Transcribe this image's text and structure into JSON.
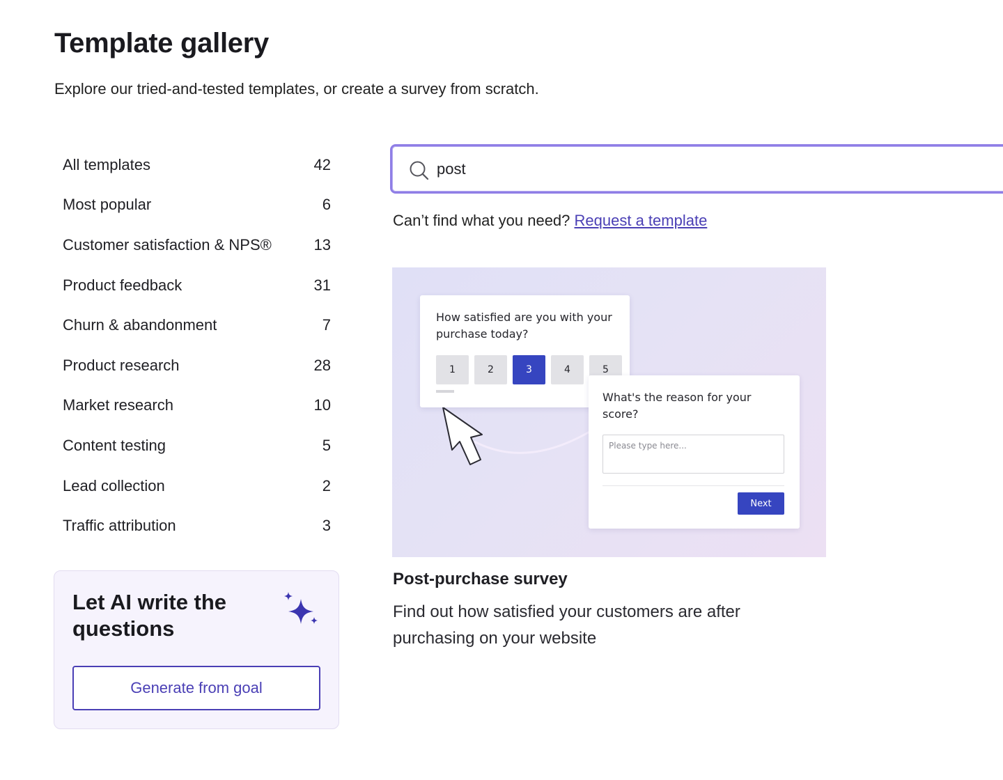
{
  "header": {
    "title": "Template gallery",
    "subtitle": "Explore our tried-and-tested templates, or create a survey from scratch."
  },
  "sidebar": {
    "categories": [
      {
        "label": "All templates",
        "count": "42"
      },
      {
        "label": "Most popular",
        "count": "6"
      },
      {
        "label": "Customer satisfaction & NPS®",
        "count": "13"
      },
      {
        "label": "Product feedback",
        "count": "31"
      },
      {
        "label": "Churn & abandonment",
        "count": "7"
      },
      {
        "label": "Product research",
        "count": "28"
      },
      {
        "label": "Market research",
        "count": "10"
      },
      {
        "label": "Content testing",
        "count": "5"
      },
      {
        "label": "Lead collection",
        "count": "2"
      },
      {
        "label": "Traffic attribution",
        "count": "3"
      }
    ],
    "ai_card": {
      "title": "Let AI write the questions",
      "button_label": "Generate from goal",
      "icon": "sparkle-icon"
    }
  },
  "search": {
    "value": "post",
    "icon": "search-icon"
  },
  "request": {
    "prompt": "Can’t find what you need?",
    "link_label": "Request a template"
  },
  "template": {
    "title": "Post-purchase survey",
    "description": "Find out how satisfied your customers are after purchasing on your website",
    "preview": {
      "question_1": "How satisfied are you with your purchase today?",
      "ratings": [
        "1",
        "2",
        "3",
        "4",
        "5"
      ],
      "selected_rating": "3",
      "question_2": "What's the reason for your score?",
      "placeholder": "Please type here...",
      "next_label": "Next"
    }
  },
  "colors": {
    "accent": "#4a3fb5",
    "search_border": "#8f7ee6",
    "ai_card_bg": "#f6f3fd",
    "preview_button": "#3645c0"
  }
}
